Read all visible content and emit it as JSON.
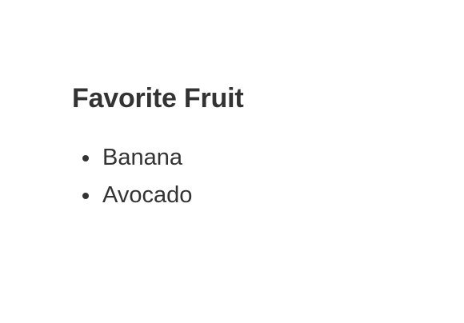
{
  "heading": "Favorite Fruit",
  "fruits": [
    {
      "label": "Banana"
    },
    {
      "label": "Avocado"
    }
  ],
  "colors": {
    "text": "#333333",
    "background": "#ffffff"
  }
}
